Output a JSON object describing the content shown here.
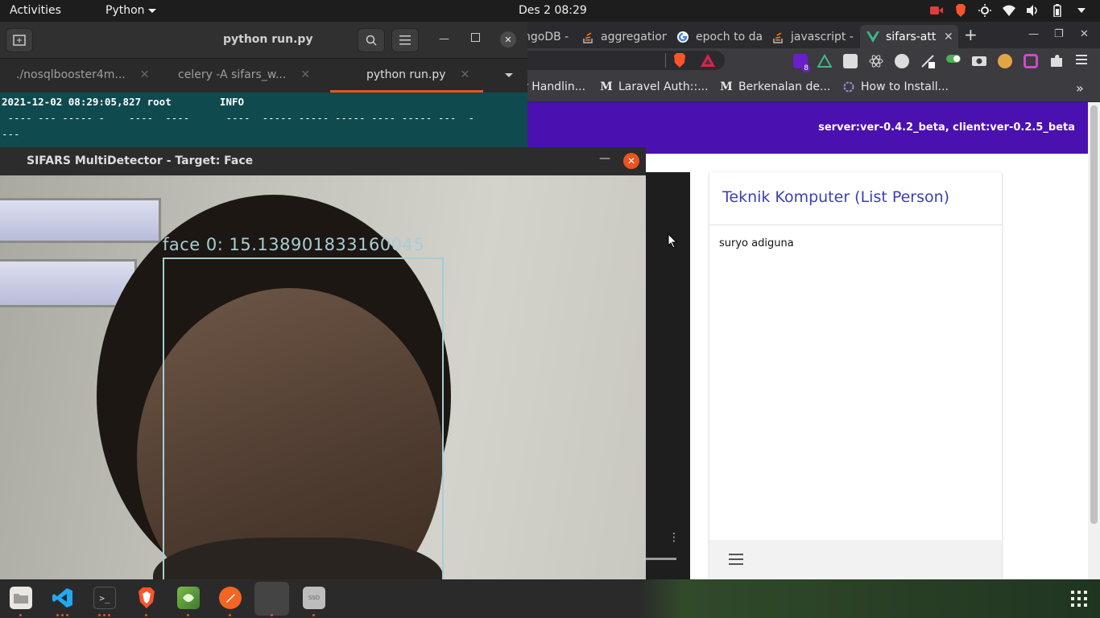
{
  "topbar": {
    "activities": "Activities",
    "app_name": "Python",
    "clock": "Des 2  08:29"
  },
  "browser": {
    "tabs": [
      {
        "label": "ngoDB -",
        "icon": "mongodb-icon"
      },
      {
        "label": "aggregation",
        "icon": "stackoverflow-icon"
      },
      {
        "label": "epoch to da",
        "icon": "google-icon"
      },
      {
        "label": "javascript -",
        "icon": "stackoverflow-icon"
      },
      {
        "label": "sifars-att",
        "icon": "vue-icon"
      }
    ],
    "bookmarks": [
      {
        "label": "r Handlin..."
      },
      {
        "label": "Laravel Auth::..."
      },
      {
        "label": "Berkenalan de..."
      },
      {
        "label": "How to Install..."
      }
    ],
    "page": {
      "version": "server:ver-0.4.2_beta, client:ver-0.2.5_beta",
      "card_title": "Teknik Komputer (List Person)",
      "person": "suryo adiguna"
    },
    "extension_badge": "8"
  },
  "terminal": {
    "title": "python run.py",
    "tabs": [
      {
        "label": "./nosqlbooster4m..."
      },
      {
        "label": "celery -A sifars_w..."
      },
      {
        "label": "python run.py"
      }
    ],
    "lines": [
      "2021-12-02 08:29:05,827 root        INFO",
      " ---- --- ----- -    ----  ----      ----  ----- ----- ----- ---- ----- ---  -",
      "---"
    ]
  },
  "camera_window": {
    "title": "SIFARS MultiDetector - Target: Face",
    "detection_label": "face 0: 15.138901833160045"
  },
  "colors": {
    "accent": "#e95420",
    "page_header": "#4a10b0",
    "card_title": "#3b3fb8",
    "detection": "#a8cdd6",
    "terminal_bg": "#0f4a4f"
  }
}
